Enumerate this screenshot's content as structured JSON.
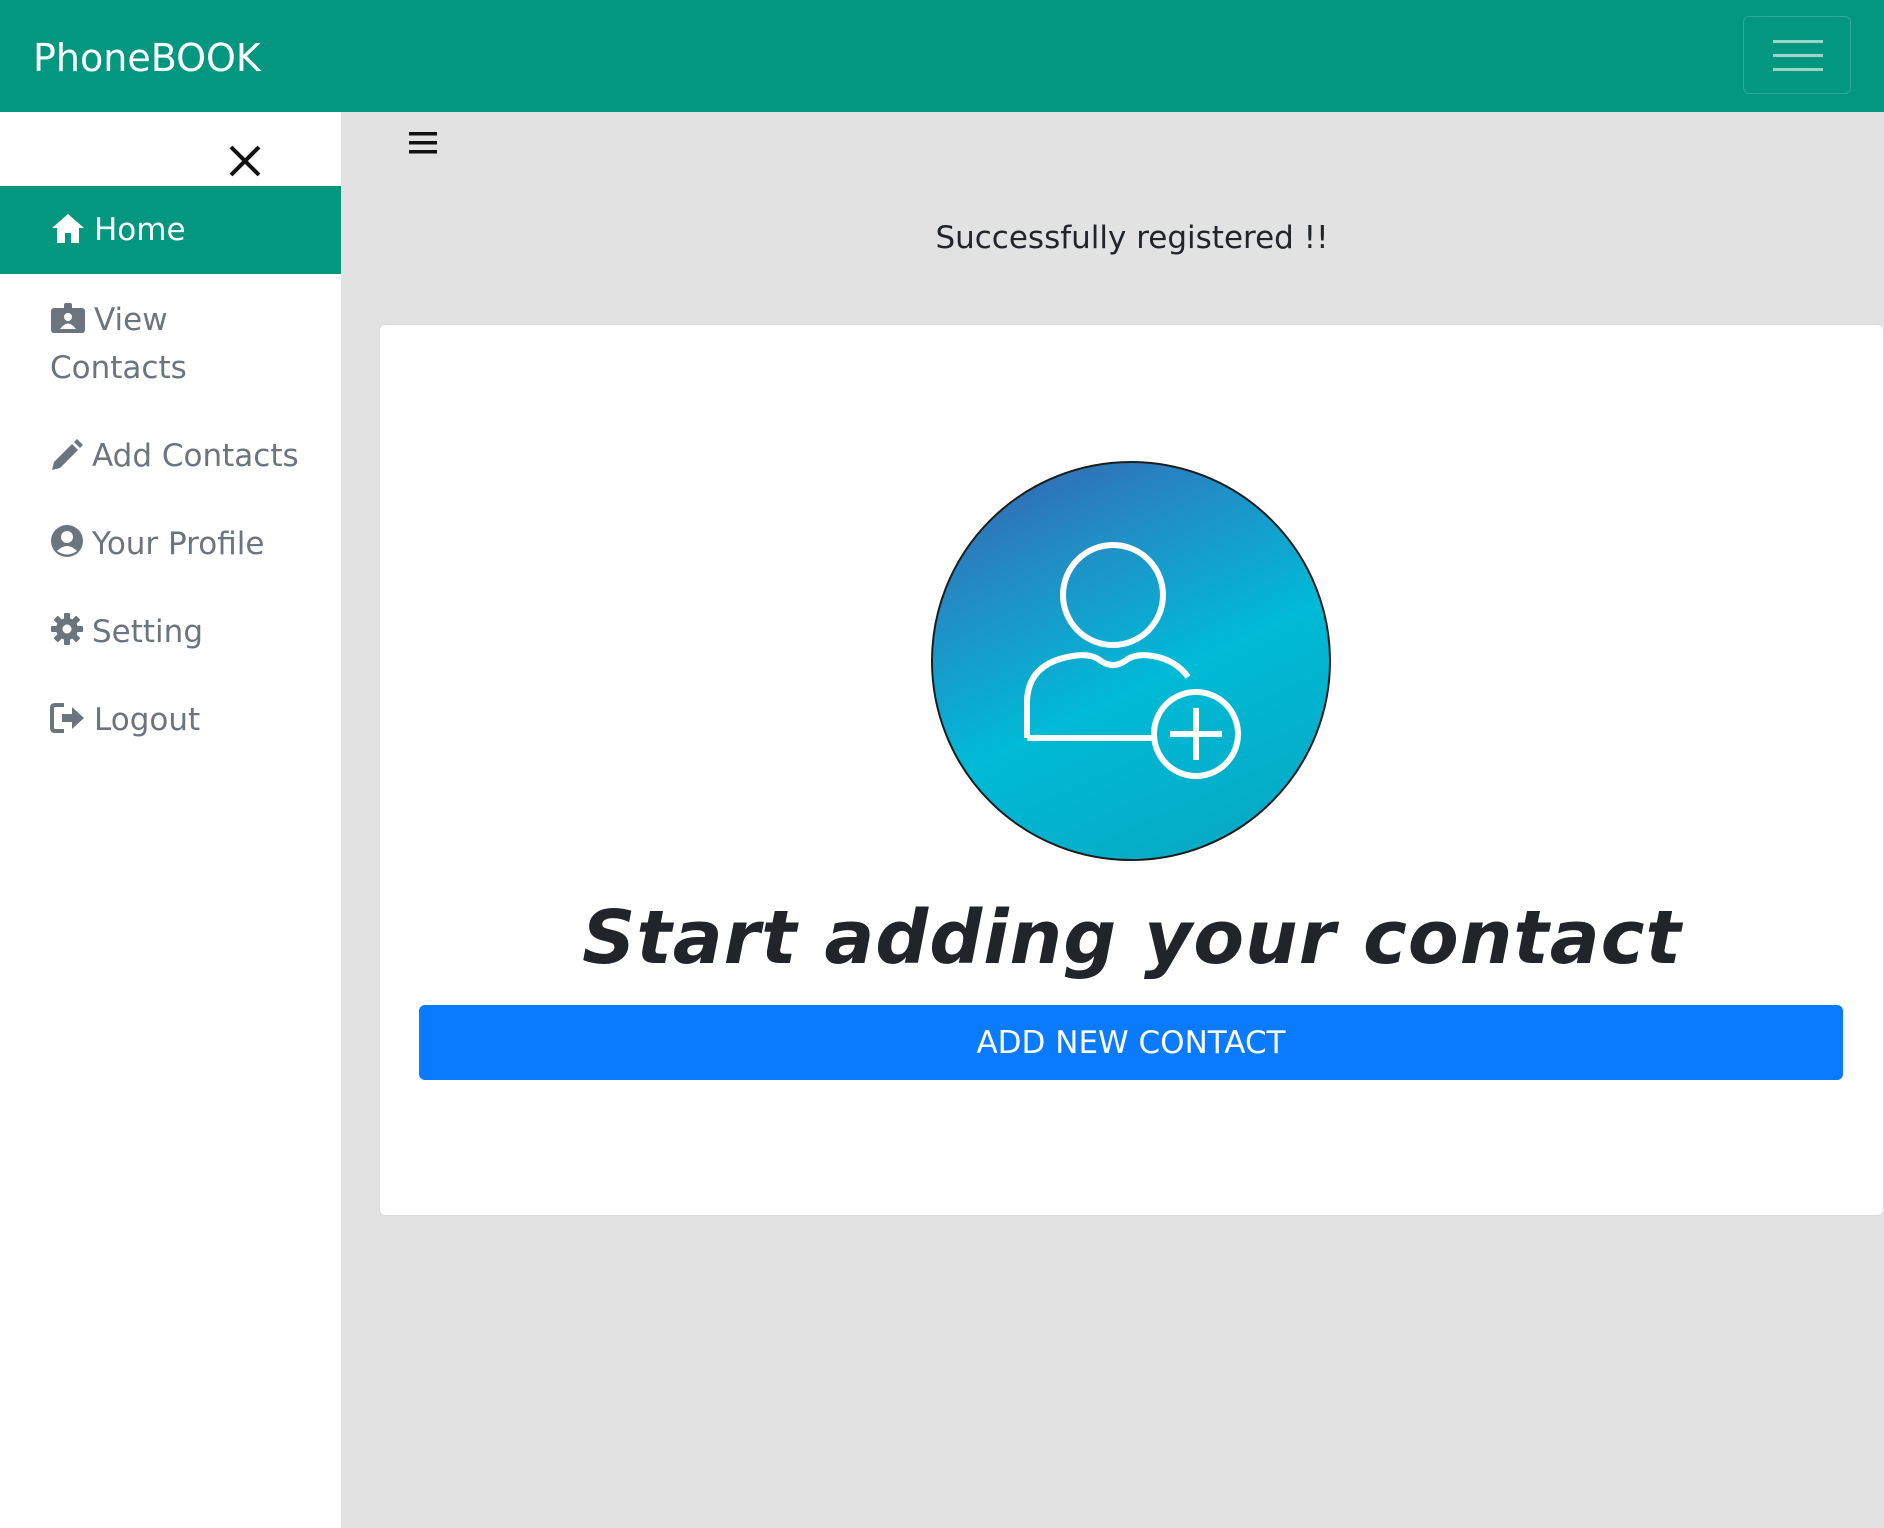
{
  "navbar": {
    "brand": "PhoneBOOK",
    "toggler_icon": "hamburger-icon"
  },
  "sidebar": {
    "close_icon": "close-icon",
    "items": [
      {
        "label": "Home",
        "icon": "home-icon",
        "active": true
      },
      {
        "label": "View Contacts",
        "icon": "id-card-icon",
        "active": false
      },
      {
        "label": "Add Contacts",
        "icon": "pencil-icon",
        "active": false
      },
      {
        "label": "Your Profile",
        "icon": "user-circle-icon",
        "active": false
      },
      {
        "label": "Setting",
        "icon": "gear-icon",
        "active": false
      },
      {
        "label": "Logout",
        "icon": "logout-icon",
        "active": false
      }
    ]
  },
  "main": {
    "toggle_icon": "hamburger-icon",
    "message": "Successfully registered !!",
    "card": {
      "image_icon": "add-user-icon",
      "headline": "Start adding your contact",
      "button_label": "ADD NEW CONTACT"
    }
  },
  "colors": {
    "primary": "#039780",
    "button": "#0a7bff",
    "background": "#e2e2e2",
    "muted_text": "#6c757d"
  }
}
